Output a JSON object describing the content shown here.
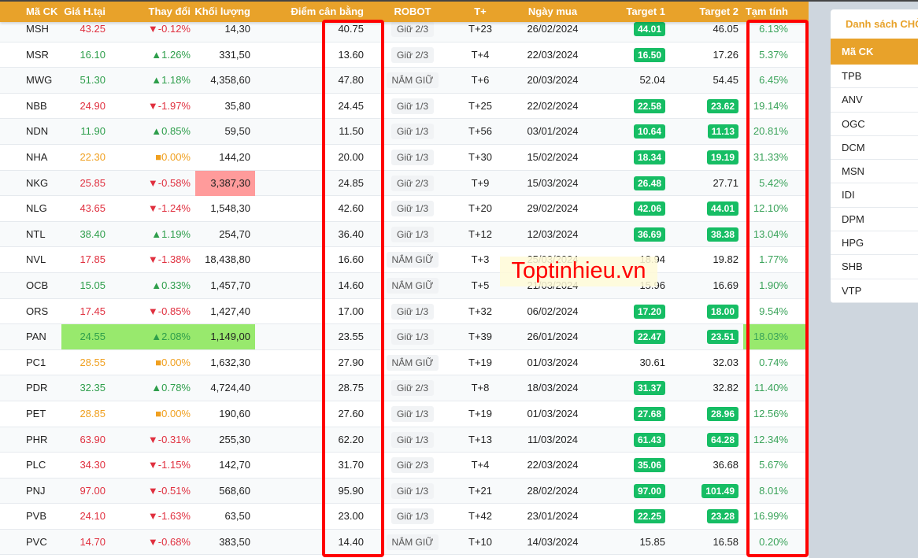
{
  "headers": {
    "ma": "Mã CK",
    "gia": "Giá H.tại",
    "thaydoi": "Thay đổi",
    "kl": "Khối lượng",
    "diem": "Điểm cân bằng",
    "robot": "ROBOT",
    "t": "T+",
    "ngay": "Ngày mua",
    "t1": "Target 1",
    "t2": "Target 2",
    "tam": "Tạm tính"
  },
  "colors": {
    "header": "#e8a22a",
    "up": "#2e9e4b",
    "down": "#e0303f",
    "flat": "#f0a020",
    "badge": "#16bd64",
    "highlight_red": "#ff9b9b",
    "highlight_green": "#98e96d",
    "box": "#ff0000"
  },
  "rows": [
    {
      "ma": "MSH",
      "gia": "43.25",
      "dir": "down",
      "chg": "-0.12%",
      "kl": "14,30",
      "diem": "40.75",
      "robot": "Giữ 2/3",
      "t": "T+23",
      "ngay": "26/02/2024",
      "t1": "44.01",
      "t1b": true,
      "t2": "46.05",
      "t2b": false,
      "tam": "6.13%"
    },
    {
      "ma": "MSR",
      "gia": "16.10",
      "dir": "up",
      "chg": "1.26%",
      "kl": "331,50",
      "diem": "13.60",
      "robot": "Giữ 2/3",
      "t": "T+4",
      "ngay": "22/03/2024",
      "t1": "16.50",
      "t1b": true,
      "t2": "17.26",
      "t2b": false,
      "tam": "5.37%"
    },
    {
      "ma": "MWG",
      "gia": "51.30",
      "dir": "up",
      "chg": "1.18%",
      "kl": "4,358,60",
      "diem": "47.80",
      "robot": "NẮM GIỮ",
      "t": "T+6",
      "ngay": "20/03/2024",
      "t1": "52.04",
      "t1b": false,
      "t2": "54.45",
      "t2b": false,
      "tam": "6.45%"
    },
    {
      "ma": "NBB",
      "gia": "24.90",
      "dir": "down",
      "chg": "-1.97%",
      "kl": "35,80",
      "diem": "24.45",
      "robot": "Giữ 1/3",
      "t": "T+25",
      "ngay": "22/02/2024",
      "t1": "22.58",
      "t1b": true,
      "t2": "23.62",
      "t2b": true,
      "tam": "19.14%"
    },
    {
      "ma": "NDN",
      "gia": "11.90",
      "dir": "up",
      "chg": "0.85%",
      "kl": "59,50",
      "diem": "11.50",
      "robot": "Giữ 1/3",
      "t": "T+56",
      "ngay": "03/01/2024",
      "t1": "10.64",
      "t1b": true,
      "t2": "11.13",
      "t2b": true,
      "tam": "20.81%"
    },
    {
      "ma": "NHA",
      "gia": "22.30",
      "dir": "flat",
      "chg": "0.00%",
      "kl": "144,20",
      "diem": "20.00",
      "robot": "Giữ 1/3",
      "t": "T+30",
      "ngay": "15/02/2024",
      "t1": "18.34",
      "t1b": true,
      "t2": "19.19",
      "t2b": true,
      "tam": "31.33%"
    },
    {
      "ma": "NKG",
      "gia": "25.85",
      "dir": "down",
      "chg": "-0.58%",
      "kl": "3,387,30",
      "klhl": "red",
      "diem": "24.85",
      "robot": "Giữ 2/3",
      "t": "T+9",
      "ngay": "15/03/2024",
      "t1": "26.48",
      "t1b": true,
      "t2": "27.71",
      "t2b": false,
      "tam": "5.42%"
    },
    {
      "ma": "NLG",
      "gia": "43.65",
      "dir": "down",
      "chg": "-1.24%",
      "kl": "1,548,30",
      "diem": "42.60",
      "robot": "Giữ 1/3",
      "t": "T+20",
      "ngay": "29/02/2024",
      "t1": "42.06",
      "t1b": true,
      "t2": "44.01",
      "t2b": true,
      "tam": "12.10%"
    },
    {
      "ma": "NTL",
      "gia": "38.40",
      "dir": "up",
      "chg": "1.19%",
      "kl": "254,70",
      "diem": "36.40",
      "robot": "Giữ 1/3",
      "t": "T+12",
      "ngay": "12/03/2024",
      "t1": "36.69",
      "t1b": true,
      "t2": "38.38",
      "t2b": true,
      "tam": "13.04%"
    },
    {
      "ma": "NVL",
      "gia": "17.85",
      "dir": "down",
      "chg": "-1.38%",
      "kl": "18,438,80",
      "diem": "16.60",
      "robot": "NẮM GIỮ",
      "t": "T+3",
      "ngay": "25/03/2024",
      "t1": "18.94",
      "t1b": false,
      "t2": "19.82",
      "t2b": false,
      "tam": "1.77%"
    },
    {
      "ma": "OCB",
      "gia": "15.05",
      "dir": "up",
      "chg": "0.33%",
      "kl": "1,457,70",
      "diem": "14.60",
      "robot": "NẮM GIỮ",
      "t": "T+5",
      "ngay": "21/03/2024",
      "t1": "15.96",
      "t1b": false,
      "t2": "16.69",
      "t2b": false,
      "tam": "1.90%"
    },
    {
      "ma": "ORS",
      "gia": "17.45",
      "dir": "down",
      "chg": "-0.85%",
      "kl": "1,427,40",
      "diem": "17.00",
      "robot": "Giữ 1/3",
      "t": "T+32",
      "ngay": "06/02/2024",
      "t1": "17.20",
      "t1b": true,
      "t2": "18.00",
      "t2b": true,
      "tam": "9.54%"
    },
    {
      "ma": "PAN",
      "gia": "24.55",
      "dir": "up",
      "chg": "2.08%",
      "kl": "1,149,00",
      "hl": "green",
      "diem": "23.55",
      "robot": "Giữ 1/3",
      "t": "T+39",
      "ngay": "26/01/2024",
      "t1": "22.47",
      "t1b": true,
      "t2": "23.51",
      "t2b": true,
      "tam": "18.03%"
    },
    {
      "ma": "PC1",
      "gia": "28.55",
      "dir": "flat",
      "chg": "0.00%",
      "kl": "1,632,30",
      "diem": "27.90",
      "robot": "NẮM GIỮ",
      "t": "T+19",
      "ngay": "01/03/2024",
      "t1": "30.61",
      "t1b": false,
      "t2": "32.03",
      "t2b": false,
      "tam": "0.74%"
    },
    {
      "ma": "PDR",
      "gia": "32.35",
      "dir": "up",
      "chg": "0.78%",
      "kl": "4,724,40",
      "diem": "28.75",
      "robot": "Giữ 2/3",
      "t": "T+8",
      "ngay": "18/03/2024",
      "t1": "31.37",
      "t1b": true,
      "t2": "32.82",
      "t2b": false,
      "tam": "11.40%"
    },
    {
      "ma": "PET",
      "gia": "28.85",
      "dir": "flat",
      "chg": "0.00%",
      "kl": "190,60",
      "diem": "27.60",
      "robot": "Giữ 1/3",
      "t": "T+19",
      "ngay": "01/03/2024",
      "t1": "27.68",
      "t1b": true,
      "t2": "28.96",
      "t2b": true,
      "tam": "12.56%"
    },
    {
      "ma": "PHR",
      "gia": "63.90",
      "dir": "down",
      "chg": "-0.31%",
      "kl": "255,30",
      "diem": "62.20",
      "robot": "Giữ 1/3",
      "t": "T+13",
      "ngay": "11/03/2024",
      "t1": "61.43",
      "t1b": true,
      "t2": "64.28",
      "t2b": true,
      "tam": "12.34%"
    },
    {
      "ma": "PLC",
      "gia": "34.30",
      "dir": "down",
      "chg": "-1.15%",
      "kl": "142,70",
      "diem": "31.70",
      "robot": "Giữ 2/3",
      "t": "T+4",
      "ngay": "22/03/2024",
      "t1": "35.06",
      "t1b": true,
      "t2": "36.68",
      "t2b": false,
      "tam": "5.67%"
    },
    {
      "ma": "PNJ",
      "gia": "97.00",
      "dir": "down",
      "chg": "-0.51%",
      "kl": "568,60",
      "diem": "95.90",
      "robot": "Giữ 1/3",
      "t": "T+21",
      "ngay": "28/02/2024",
      "t1": "97.00",
      "t1b": true,
      "t2": "101.49",
      "t2b": true,
      "tam": "8.01%"
    },
    {
      "ma": "PVB",
      "gia": "24.10",
      "dir": "down",
      "chg": "-1.63%",
      "kl": "63,50",
      "diem": "23.00",
      "robot": "Giữ 1/3",
      "t": "T+42",
      "ngay": "23/01/2024",
      "t1": "22.25",
      "t1b": true,
      "t2": "23.28",
      "t2b": true,
      "tam": "16.99%"
    },
    {
      "ma": "PVC",
      "gia": "14.70",
      "dir": "down",
      "chg": "-0.68%",
      "kl": "383,50",
      "diem": "14.40",
      "robot": "NẮM GIỮ",
      "t": "T+10",
      "ngay": "14/03/2024",
      "t1": "15.85",
      "t1b": false,
      "t2": "16.58",
      "t2b": false,
      "tam": "0.20%"
    }
  ],
  "watermark": "Toptinhieu.vn",
  "side": {
    "title": "Danh sách CHỜ",
    "header": "Mã CK",
    "items": [
      "TPB",
      "ANV",
      "OGC",
      "DCM",
      "MSN",
      "IDI",
      "DPM",
      "HPG",
      "SHB",
      "VTP"
    ]
  }
}
